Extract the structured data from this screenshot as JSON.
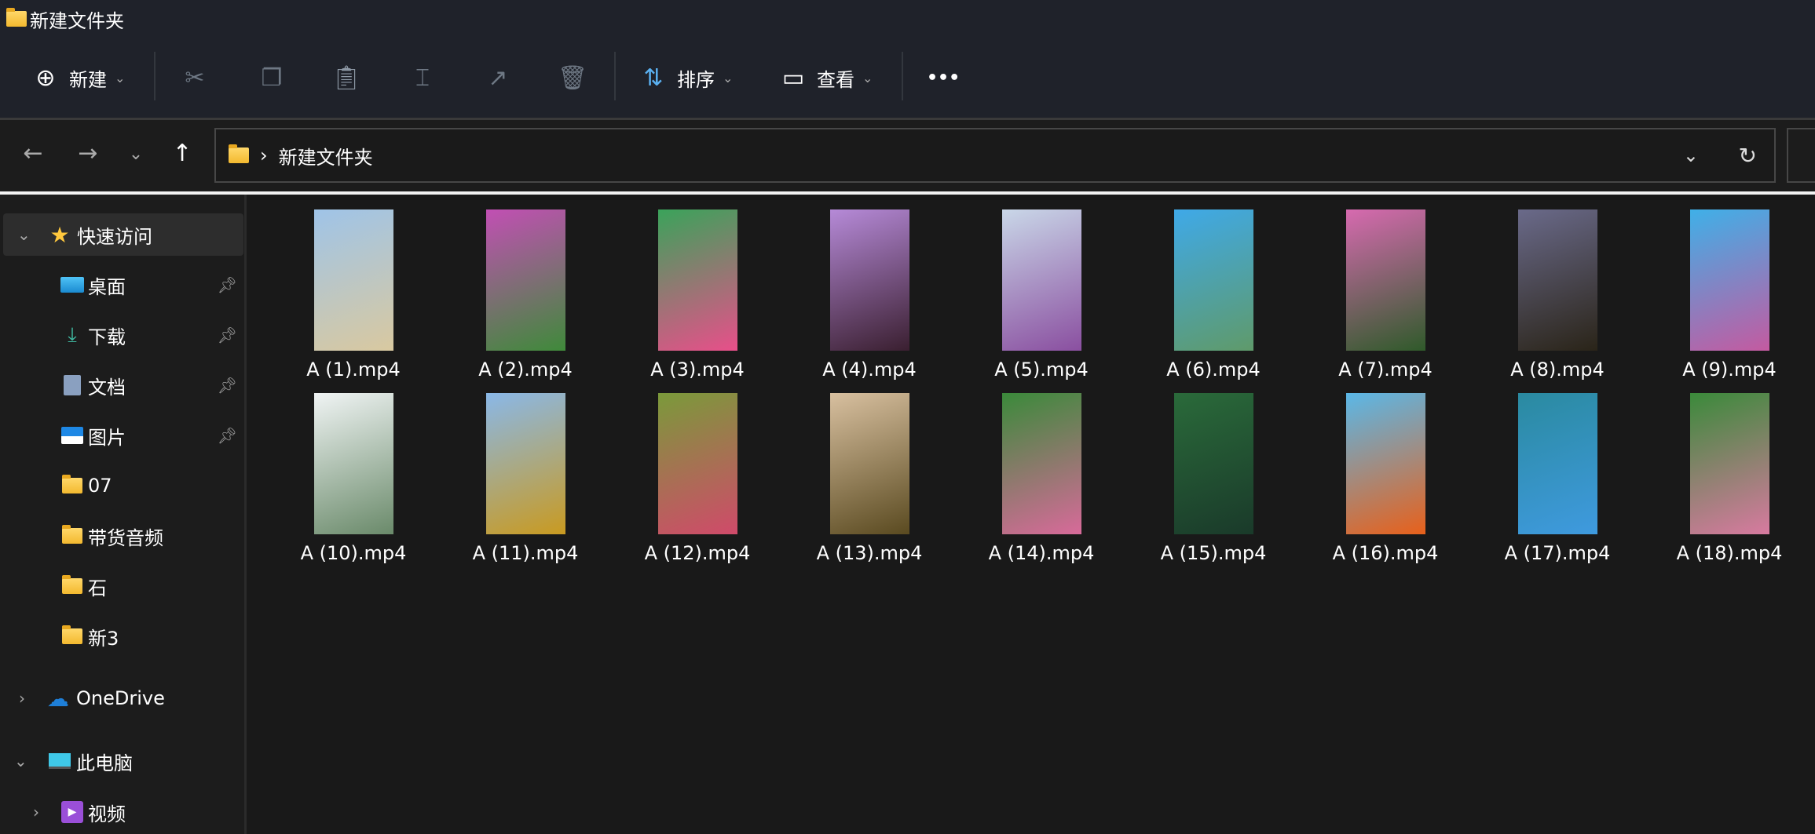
{
  "window": {
    "title": "新建文件夹"
  },
  "toolbar": {
    "new_label": "新建",
    "sort_label": "排序",
    "view_label": "查看",
    "more_label": "•••"
  },
  "address": {
    "path": "新建文件夹",
    "separator": "›"
  },
  "sidebar": {
    "quick_access": "快速访问",
    "items": [
      {
        "label": "桌面",
        "icon": "desktop-icon",
        "pinned": true
      },
      {
        "label": "下载",
        "icon": "download-icon",
        "pinned": true
      },
      {
        "label": "文档",
        "icon": "documents-icon",
        "pinned": true
      },
      {
        "label": "图片",
        "icon": "pictures-icon",
        "pinned": true
      },
      {
        "label": "07",
        "icon": "folder-icon"
      },
      {
        "label": "带货音频",
        "icon": "folder-icon"
      },
      {
        "label": "石",
        "icon": "folder-icon"
      },
      {
        "label": "新3",
        "icon": "folder-icon"
      }
    ],
    "onedrive": "OneDrive",
    "this_pc": "此电脑",
    "videos": "视频"
  },
  "files": [
    {
      "name": "A (1).mp4",
      "colors": [
        "#9fc4e8",
        "#d9c9a0"
      ]
    },
    {
      "name": "A (2).mp4",
      "colors": [
        "#c24fb4",
        "#3f8a3a"
      ]
    },
    {
      "name": "A (3).mp4",
      "colors": [
        "#3aa35a",
        "#e84f8a"
      ]
    },
    {
      "name": "A (4).mp4",
      "colors": [
        "#b68ad8",
        "#3a1f30"
      ]
    },
    {
      "name": "A (5).mp4",
      "colors": [
        "#c9d7e8",
        "#8a4fa0"
      ]
    },
    {
      "name": "A (6).mp4",
      "colors": [
        "#3fa9e8",
        "#5f9a6a"
      ]
    },
    {
      "name": "A (7).mp4",
      "colors": [
        "#d76ab0",
        "#2f5a2a"
      ]
    },
    {
      "name": "A (8).mp4",
      "colors": [
        "#6a6a8a",
        "#2a2418"
      ]
    },
    {
      "name": "A (9).mp4",
      "colors": [
        "#3fb0e8",
        "#c45aa0"
      ]
    },
    {
      "name": "A (10).mp4",
      "colors": [
        "#f0f4f4",
        "#6a8a6a"
      ]
    },
    {
      "name": "A (11).mp4",
      "colors": [
        "#8ab8e8",
        "#c99a20"
      ]
    },
    {
      "name": "A (12).mp4",
      "colors": [
        "#7a9a3a",
        "#d04a6a"
      ]
    },
    {
      "name": "A (13).mp4",
      "colors": [
        "#d8c0a0",
        "#5a4a20"
      ]
    },
    {
      "name": "A (14).mp4",
      "colors": [
        "#3a8a3a",
        "#d86a9a"
      ]
    },
    {
      "name": "A (15).mp4",
      "colors": [
        "#2a6a3a",
        "#1a3a2a"
      ]
    },
    {
      "name": "A (16).mp4",
      "colors": [
        "#5ab8e8",
        "#e8601a"
      ]
    },
    {
      "name": "A (17).mp4",
      "colors": [
        "#2a8aa0",
        "#3f9adf"
      ]
    },
    {
      "name": "A (18).mp4",
      "colors": [
        "#3a8a3a",
        "#d87aa0"
      ]
    }
  ]
}
